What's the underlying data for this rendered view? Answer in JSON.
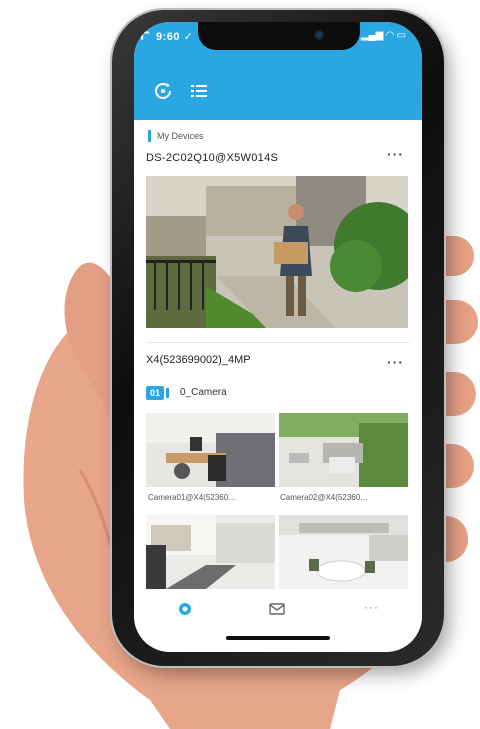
{
  "status_bar": {
    "time": "9:60 ✓",
    "icons": "▂▄▆ ◠ ▭"
  },
  "toolbar": {
    "refresh_icon": "refresh-icon",
    "list_icon": "list-icon",
    "add_label": "+"
  },
  "device_list": {
    "section_label": "My Devices",
    "devices": [
      {
        "name": "DS-2C02Q10@X5W014S",
        "more": "···"
      },
      {
        "name": "X4(523699002)_4MP",
        "more": "···"
      }
    ],
    "channel": {
      "badge": "01",
      "label": "0_Camera"
    },
    "thumbnails": [
      {
        "label": "Camera01@X4(52360…"
      },
      {
        "label": "Camera02@X4(52360…"
      }
    ]
  },
  "bottom_nav": {
    "home_icon": "camera-icon",
    "message_icon": "mail-icon",
    "more_label": "···"
  },
  "colors": {
    "accent": "#2aa7e3",
    "skin": "#e8a58a"
  }
}
